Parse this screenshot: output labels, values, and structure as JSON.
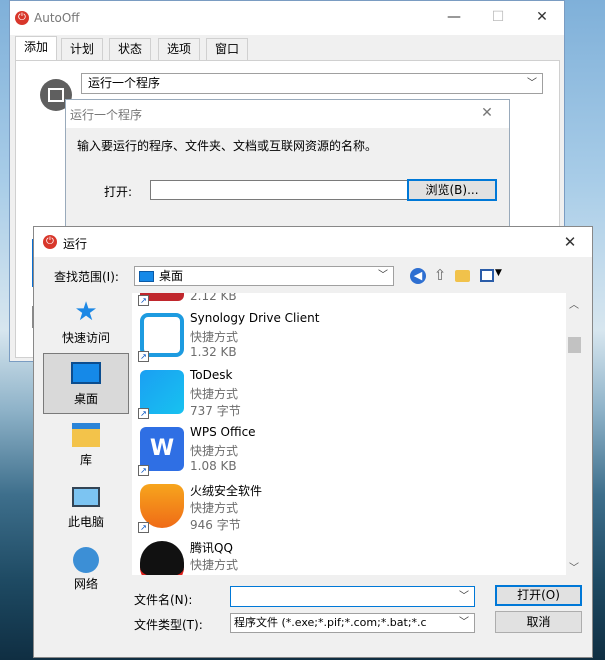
{
  "autooff": {
    "title": "AutoOff",
    "min_glyph": "—",
    "max_glyph": "☐",
    "close_glyph": "✕",
    "tabs": [
      {
        "label": "添加"
      },
      {
        "label": "计划"
      },
      {
        "label": "状态"
      },
      {
        "label": "选项"
      },
      {
        "label": "窗口"
      }
    ],
    "action_select_value": "运行一个程序"
  },
  "run_program_dialog": {
    "title": "运行一个程序",
    "close_glyph": "✕",
    "description": "输入要运行的程序、文件夹、文档或互联网资源的名称。",
    "open_label": "打开:",
    "open_value": "",
    "browse_label": "浏览(B)..."
  },
  "file_dialog": {
    "title": "运行",
    "close_glyph": "✕",
    "look_in_label": "查找范围(I):",
    "look_in_value": "桌面",
    "places": [
      {
        "label": "快速访问"
      },
      {
        "label": "桌面"
      },
      {
        "label": "库"
      },
      {
        "label": "此电脑"
      },
      {
        "label": "网络"
      }
    ],
    "selected_place": "桌面",
    "files": [
      {
        "name": "",
        "type": "",
        "size": "2.12 KB",
        "icon": "red-app-icon"
      },
      {
        "name": "Synology Drive Client",
        "type": "快捷方式",
        "size": "1.32 KB",
        "icon": "synology-drive-icon"
      },
      {
        "name": "ToDesk",
        "type": "快捷方式",
        "size": "737 字节",
        "icon": "todesk-icon"
      },
      {
        "name": "WPS Office",
        "type": "快捷方式",
        "size": "1.08 KB",
        "icon": "wps-office-icon"
      },
      {
        "name": "火绒安全软件",
        "type": "快捷方式",
        "size": "946 字节",
        "icon": "huorong-icon"
      },
      {
        "name": "腾讯QQ",
        "type": "快捷方式",
        "size": "",
        "icon": "qq-icon"
      }
    ],
    "filename_label": "文件名(N):",
    "filename_value": "",
    "filetype_label": "文件类型(T):",
    "filetype_value": "程序文件 (*.exe;*.pif;*.com;*.bat;*.c",
    "open_button": "打开(O)",
    "cancel_button": "取消"
  },
  "colors": {
    "accent": "#0078d7",
    "power_icon": "#d8372b",
    "selection": "#cce8ff"
  }
}
